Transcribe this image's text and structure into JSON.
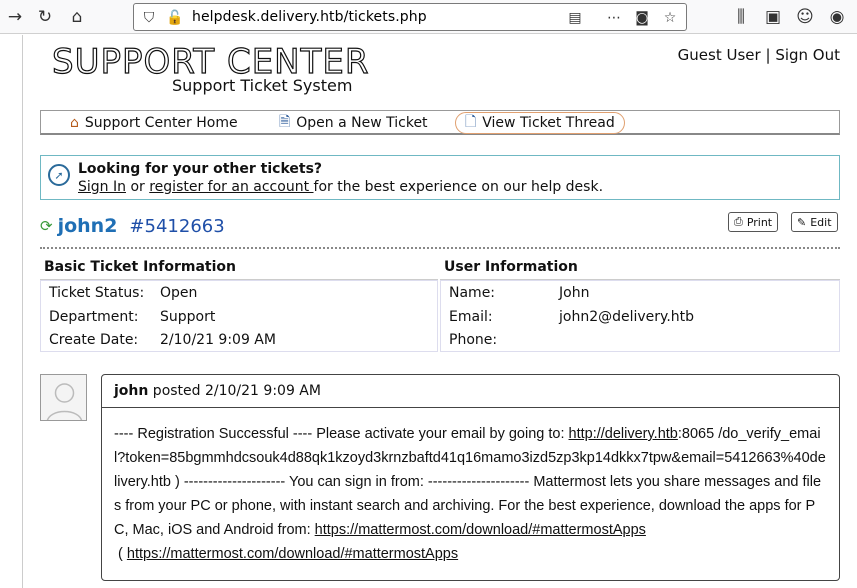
{
  "browser": {
    "url": "helpdesk.delivery.htb/tickets.php"
  },
  "header": {
    "logo_title": "SUPPORT CENTER",
    "logo_subtitle": "Support Ticket System",
    "guest_user": "Guest User",
    "separator": "|",
    "sign_out": "Sign Out"
  },
  "nav": {
    "home": "Support Center Home",
    "new_ticket": "Open a New Ticket",
    "view_thread": "View Ticket Thread"
  },
  "notice": {
    "title": "Looking for your other tickets?",
    "sign_in": "Sign In",
    "or": " or ",
    "register": "register for an account ",
    "rest": "for the best experience on our help desk."
  },
  "ticket": {
    "user": "john2",
    "number": "#5412663",
    "print_label": "Print",
    "edit_label": "Edit"
  },
  "basic_info": {
    "heading": "Basic Ticket Information",
    "status_label": "Ticket Status:",
    "status_value": "Open",
    "department_label": "Department:",
    "department_value": "Support",
    "create_label": "Create Date:",
    "create_value": "2/10/21 9:09 AM"
  },
  "user_info": {
    "heading": "User Information",
    "name_label": "Name:",
    "name_value": "John",
    "email_label": "Email:",
    "email_value": "john2@delivery.htb",
    "phone_label": "Phone:",
    "phone_value": ""
  },
  "thread": {
    "author": "john",
    "posted": " posted 2/10/21 9:09 AM",
    "part1": "---- Registration Successful ---- Please activate your email by going to: ",
    "link1": "http://delivery.htb",
    "part2": ":8065 /do_verify_email?token=85bgmmhdcsouk4d88qk1kzoyd3krnzbaftd41q16mamo3izd5zp3kp14dkkx7tpw&email=5412663%40delivery.htb ) --------------------- You can sign in from: --------------------- Mattermost lets you share messages and files from your PC or phone, with instant search and archiving. For the best experience, download the apps for PC, Mac, iOS and Android from: ",
    "link2": "https://mattermost.com/download/#mattermostApps",
    "part3": " ( ",
    "link3": "https://mattermost.com/download/#mattermostApps"
  }
}
